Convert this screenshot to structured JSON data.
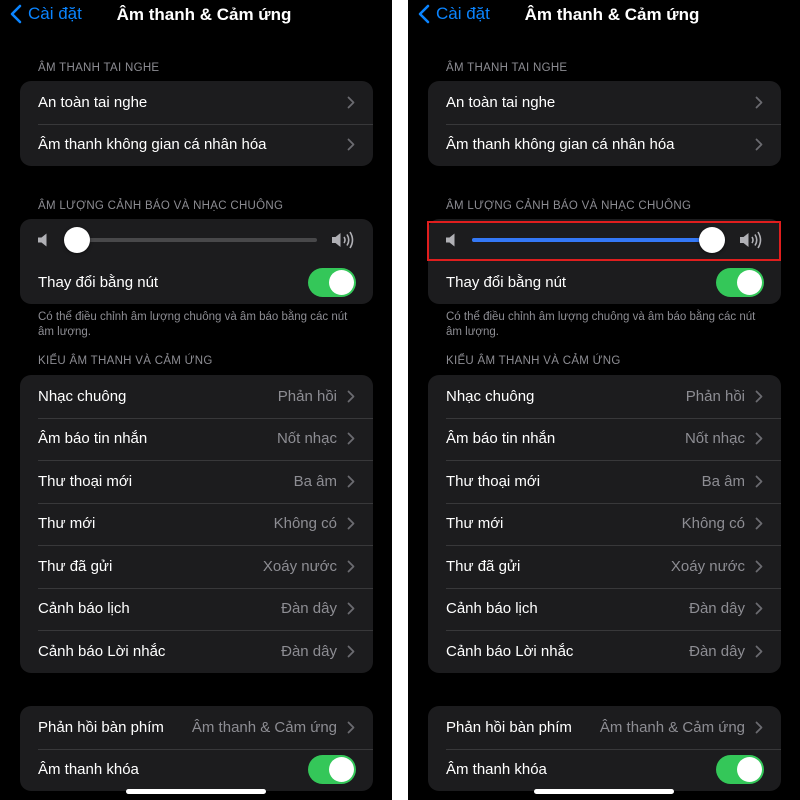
{
  "colors": {
    "accent": "#0a84ff",
    "toggle_on": "#34c759",
    "slider_fill": "#3478f6",
    "highlight": "#e01e1e"
  },
  "nav": {
    "back_label": "Cài đặt",
    "title": "Âm thanh & Cảm ứng"
  },
  "headphone_section": {
    "label": "ÂM THANH TAI NGHE",
    "items": [
      {
        "label": "An toàn tai nghe"
      },
      {
        "label": "Âm thanh không gian cá nhân hóa"
      }
    ]
  },
  "volume_section": {
    "label": "ÂM LƯỢNG CẢNH BÁO VÀ NHẠC CHUÔNG",
    "toggle_label": "Thay đổi bằng nút",
    "footnote": "Có thể điều chỉnh âm lượng chuông và âm báo bằng các nút âm lượng."
  },
  "panels": {
    "left": {
      "volume_level": 0.0,
      "toggle_on": true
    },
    "right": {
      "volume_level": 1.0,
      "toggle_on": true,
      "highlighted": true
    }
  },
  "sounds_section": {
    "label": "KIỂU ÂM THANH VÀ CẢM ỨNG",
    "items": [
      {
        "label": "Nhạc chuông",
        "value": "Phản hồi"
      },
      {
        "label": "Âm báo tin nhắn",
        "value": "Nốt nhạc"
      },
      {
        "label": "Thư thoại mới",
        "value": "Ba âm"
      },
      {
        "label": "Thư mới",
        "value": "Không có"
      },
      {
        "label": "Thư đã gửi",
        "value": "Xoáy nước"
      },
      {
        "label": "Cảnh báo lịch",
        "value": "Đàn dây"
      },
      {
        "label": "Cảnh báo Lời nhắc",
        "value": "Đàn dây"
      }
    ]
  },
  "feedback_section": {
    "keyboard_label": "Phản hồi bàn phím",
    "keyboard_value": "Âm thanh & Cảm ứng",
    "lock_label": "Âm thanh khóa"
  }
}
